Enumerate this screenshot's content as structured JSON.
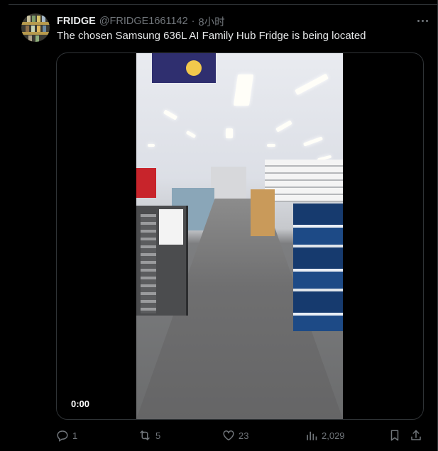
{
  "author": {
    "name": "FRIDGE",
    "handle": "@FRIDGE1661142",
    "separator": "·",
    "time": "8小时"
  },
  "tweet": {
    "text": "The chosen Samsung 636L AI Family Hub Fridge is being located"
  },
  "video": {
    "time": "0:00"
  },
  "actions": {
    "replies": "1",
    "reposts": "5",
    "likes": "23",
    "views": "2,029"
  },
  "icons": {
    "more": "more-horizontal-icon",
    "reply": "reply-icon",
    "repost": "repost-icon",
    "like": "heart-icon",
    "views": "analytics-icon",
    "bookmark": "bookmark-icon",
    "share": "share-icon"
  },
  "colors": {
    "background": "#000000",
    "text": "#e7e9ea",
    "muted": "#71767b",
    "border": "#2f3336"
  }
}
